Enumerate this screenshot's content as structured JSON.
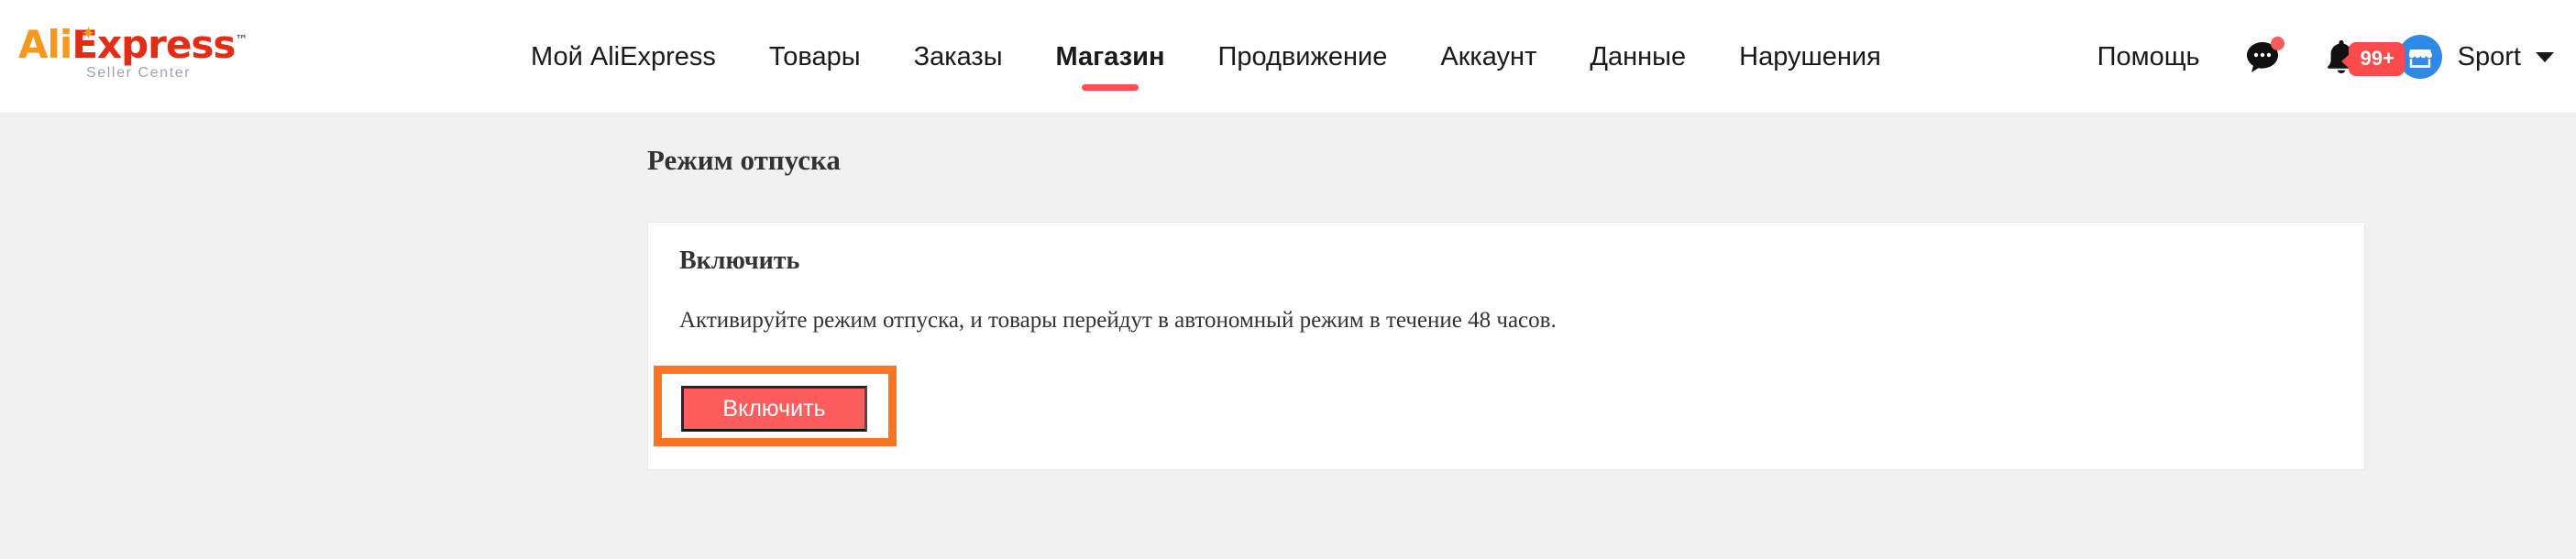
{
  "brand": {
    "logo_ali": "Ali",
    "logo_express": "Express",
    "logo_tm": "™",
    "logo_subtitle": "Seller Center"
  },
  "header": {
    "nav": [
      {
        "label": "Мой AliExpress",
        "active": false
      },
      {
        "label": "Товары",
        "active": false
      },
      {
        "label": "Заказы",
        "active": false
      },
      {
        "label": "Магазин",
        "active": true
      },
      {
        "label": "Продвижение",
        "active": false
      },
      {
        "label": "Аккаунт",
        "active": false
      },
      {
        "label": "Данные",
        "active": false
      },
      {
        "label": "Нарушения",
        "active": false
      }
    ],
    "help_label": "Помощь",
    "chat_icon": "chat-bubble-icon",
    "bell_icon": "bell-icon",
    "notification_count": "99+",
    "store_icon": "storefront-icon",
    "store_name": "Sport",
    "caret_icon": "chevron-down-icon",
    "active_underline_color": "#fe5050",
    "badge_color": "#fb4b4b",
    "avatar_color": "#2e8ae6"
  },
  "page": {
    "title": "Режим отпуска"
  },
  "card": {
    "heading": "Включить",
    "description": "Активируйте режим отпуска, и товары перейдут в автономный режим в течение 48 часов.",
    "action_label": "Включить",
    "action_color": "#fc5e5e",
    "highlight_color": "#fd7425"
  }
}
